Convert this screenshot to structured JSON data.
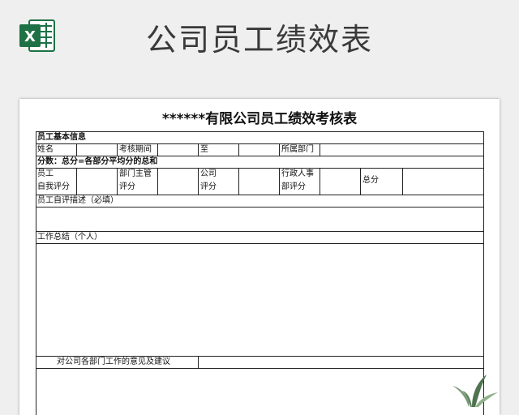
{
  "banner": {
    "title": "公司员工绩效表",
    "logo_icon": "excel-icon",
    "logo_letter": "X",
    "accent": "#1e7145"
  },
  "sheet": {
    "title": "******有限公司员工绩效考核表",
    "section_basic": "员工基本信息",
    "row_name": {
      "name_label": "姓名",
      "period_label": "考核期间",
      "to_label": "至",
      "dept_label": "所属部门"
    },
    "score_note": "分数：总分=各部分平均分的总和",
    "score_row": {
      "self_line1": "员工",
      "self_line2": "自我评分",
      "manager_line1": "部门主管",
      "manager_line2": "评分",
      "company_line1": "公司",
      "company_line2": "评分",
      "hr_line1": "行政人事",
      "hr_line2": "部评分",
      "total_label": "总分"
    },
    "self_desc_label": "员工自评描述（必填）",
    "work_summary_label": "工作总结（个人）",
    "suggestion_label": "对公司各部门工作的意见及建议"
  },
  "decor": {
    "plant_icon": "plant-icon"
  }
}
